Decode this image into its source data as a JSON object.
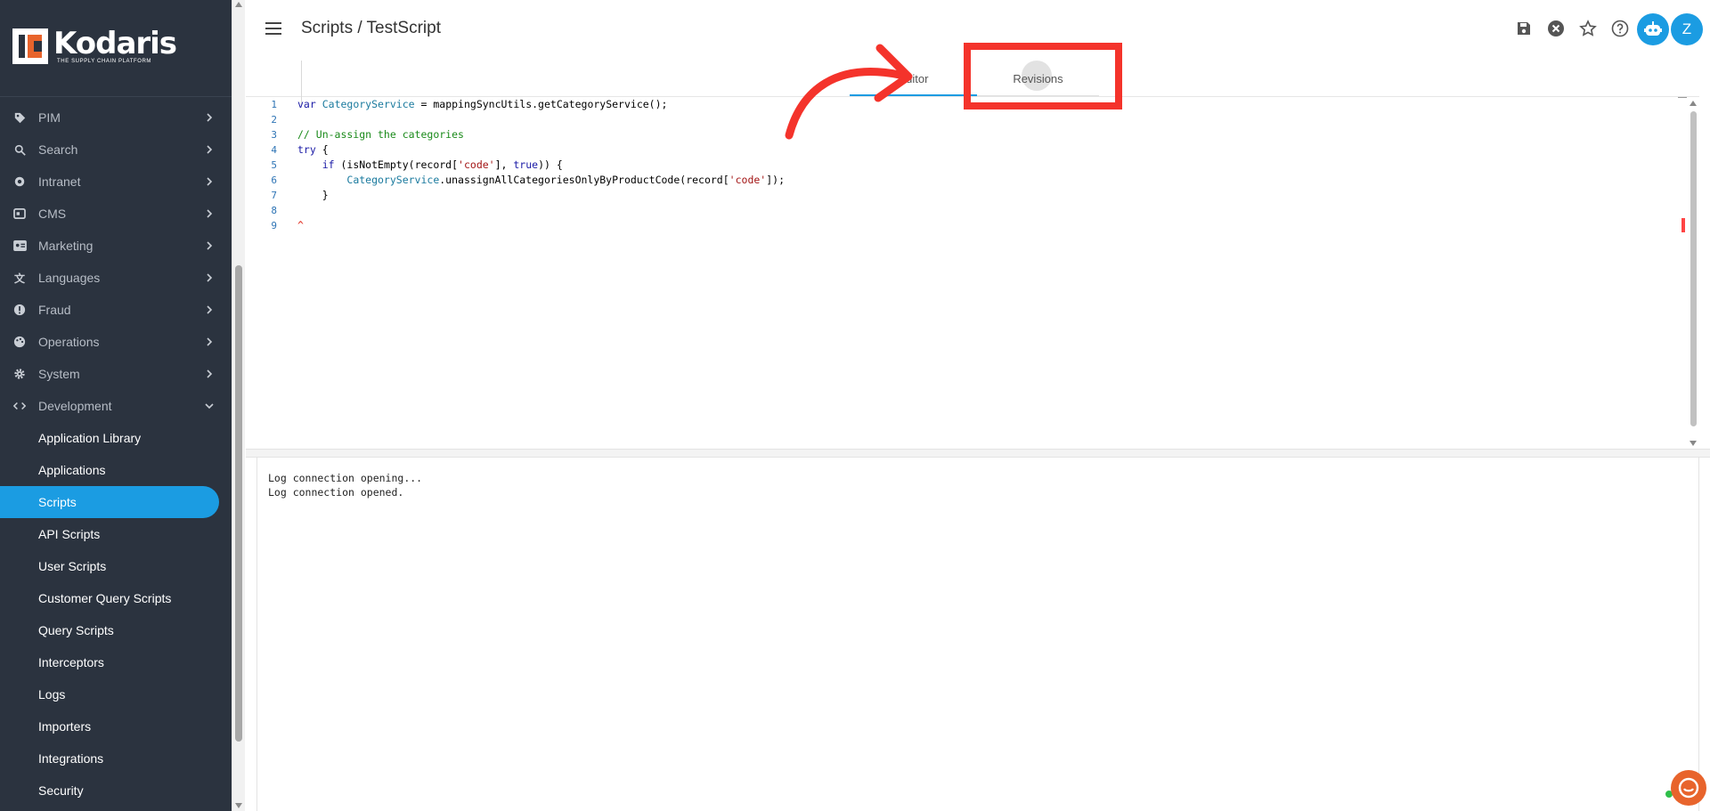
{
  "app": {
    "logo_text": "Kodaris",
    "logo_tagline": "THE SUPPLY CHAIN PLATFORM",
    "breadcrumb": "Scripts / TestScript",
    "user_initial": "Z",
    "brand_color": "#1b9ce2",
    "annotation_color": "#f4332b"
  },
  "sidebar": {
    "items": [
      {
        "label": "PIM",
        "icon": "tag-icon"
      },
      {
        "label": "Search",
        "icon": "search-icon"
      },
      {
        "label": "Intranet",
        "icon": "network-icon"
      },
      {
        "label": "CMS",
        "icon": "cms-icon"
      },
      {
        "label": "Marketing",
        "icon": "megaphone-icon"
      },
      {
        "label": "Languages",
        "icon": "translate-icon"
      },
      {
        "label": "Fraud",
        "icon": "alert-icon"
      },
      {
        "label": "Operations",
        "icon": "palette-icon"
      },
      {
        "label": "System",
        "icon": "gear-icon"
      },
      {
        "label": "Development",
        "icon": "code-icon"
      }
    ],
    "sub_items": [
      {
        "label": "Application Library"
      },
      {
        "label": "Applications"
      },
      {
        "label": "Scripts",
        "active": true
      },
      {
        "label": "API Scripts"
      },
      {
        "label": "User Scripts"
      },
      {
        "label": "Customer Query Scripts"
      },
      {
        "label": "Query Scripts"
      },
      {
        "label": "Interceptors"
      },
      {
        "label": "Logs"
      },
      {
        "label": "Importers"
      },
      {
        "label": "Integrations"
      },
      {
        "label": "Security"
      }
    ]
  },
  "header_icons": [
    "save-icon",
    "close-circle-icon",
    "star-icon",
    "help-icon",
    "robot-icon",
    "avatar"
  ],
  "tabs": [
    {
      "label": "Editor",
      "selected": true
    },
    {
      "label": "Revisions",
      "selected": false
    }
  ],
  "editor": {
    "line_numbers": [
      "1",
      "2",
      "3",
      "4",
      "5",
      "6",
      "7",
      "8",
      "9"
    ],
    "lines": [
      [
        {
          "t": "var",
          "c": "kw"
        },
        {
          "t": " "
        },
        {
          "t": "CategoryService",
          "c": "var"
        },
        {
          "t": " = mappingSyncUtils.getCategoryService();"
        }
      ],
      [],
      [
        {
          "t": "// Un-assign the categories",
          "c": "cm"
        }
      ],
      [
        {
          "t": "try",
          "c": "kw"
        },
        {
          "t": " {"
        }
      ],
      [
        {
          "t": "    "
        },
        {
          "t": "if",
          "c": "kw"
        },
        {
          "t": " (isNotEmpty(record["
        },
        {
          "t": "'code'",
          "c": "str"
        },
        {
          "t": "], "
        },
        {
          "t": "true",
          "c": "kw"
        },
        {
          "t": ")) {"
        }
      ],
      [
        {
          "t": "        "
        },
        {
          "t": "CategoryService",
          "c": "var"
        },
        {
          "t": ".unassignAllCategoriesOnlyByProductCode(record["
        },
        {
          "t": "'code'",
          "c": "str"
        },
        {
          "t": "]);"
        }
      ],
      [
        {
          "t": "    }"
        }
      ],
      [],
      [
        {
          "t": "^",
          "c": "err"
        }
      ]
    ]
  },
  "log": {
    "lines": [
      "Log connection opening...",
      "Log connection opened."
    ]
  }
}
